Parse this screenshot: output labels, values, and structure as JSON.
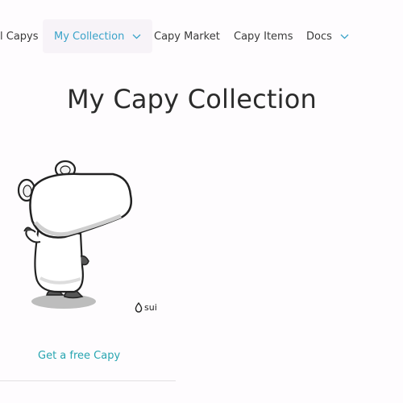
{
  "nav": {
    "items": [
      {
        "label": "l Capys"
      },
      {
        "label": "My Collection"
      },
      {
        "label": "Capy Market"
      },
      {
        "label": "Capy Items"
      },
      {
        "label": "Docs"
      }
    ]
  },
  "page": {
    "title": "My Capy Collection"
  },
  "card": {
    "brand": "sui",
    "link_label": "Get a free Capy"
  },
  "colors": {
    "accent": "#3aa3c9",
    "link": "#26a5b0",
    "active_tab_bg": "#f7f3f8"
  }
}
